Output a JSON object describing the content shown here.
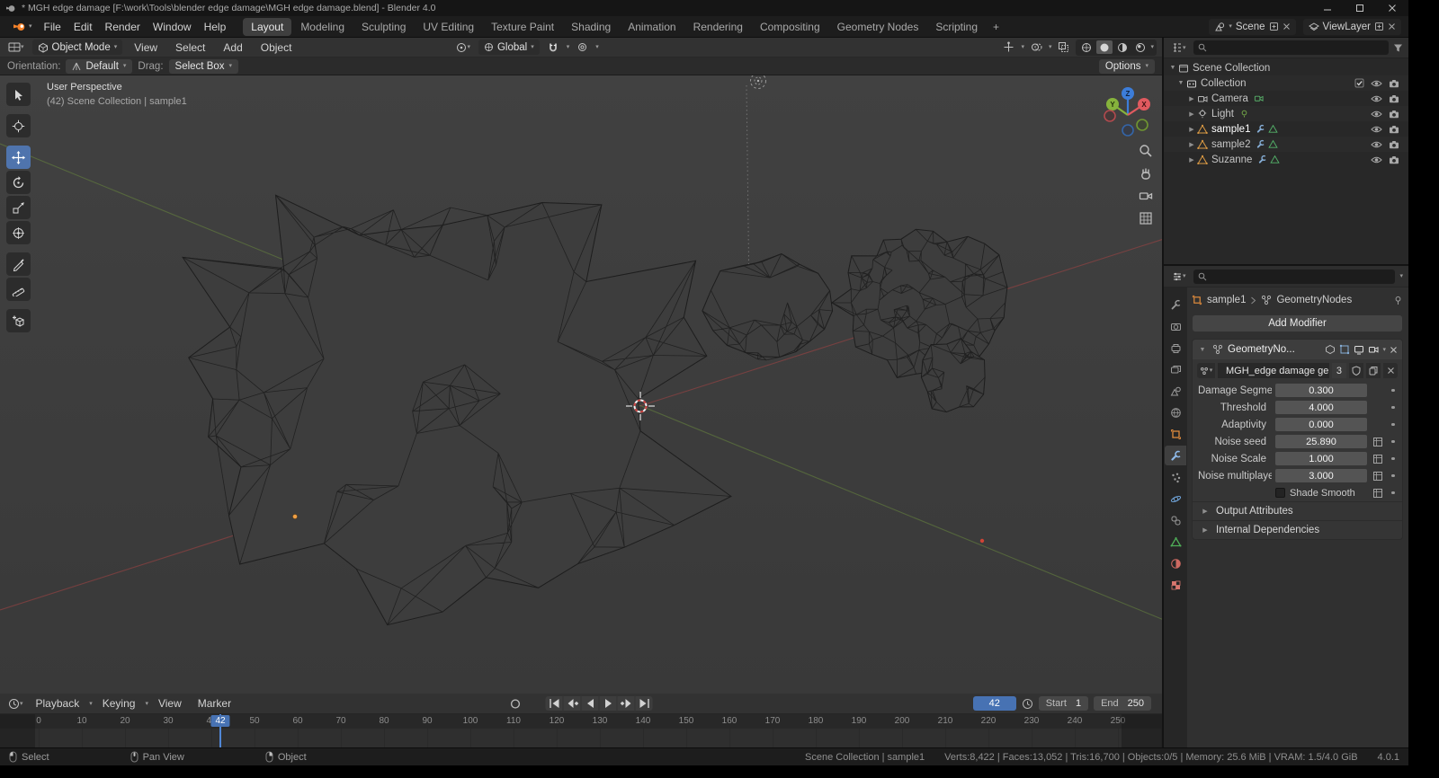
{
  "titlebar": {
    "title": "* MGH edge damage [F:\\work\\Tools\\blender edge damage\\MGH edge damage.blend] - Blender 4.0"
  },
  "topbar": {
    "menus": [
      "File",
      "Edit",
      "Render",
      "Window",
      "Help"
    ],
    "workspaces": [
      "Layout",
      "Modeling",
      "Sculpting",
      "UV Editing",
      "Texture Paint",
      "Shading",
      "Animation",
      "Rendering",
      "Compositing",
      "Geometry Nodes",
      "Scripting"
    ],
    "add_workspace": "+",
    "scene": {
      "label": "Scene"
    },
    "view_layer": {
      "label": "ViewLayer"
    }
  },
  "viewport": {
    "header": {
      "mode": "Object Mode",
      "menus": [
        "View",
        "Select",
        "Add",
        "Object"
      ],
      "transform_orientation": "Global"
    },
    "tool_settings": {
      "orientation_label": "Orientation:",
      "orientation_value": "Default",
      "drag_label": "Drag:",
      "drag_value": "Select Box",
      "options_label": "Options"
    },
    "overlay": {
      "line1": "User Perspective",
      "line2": "(42) Scene Collection | sample1"
    },
    "axis_gizmo": {
      "x": "X",
      "y": "Y",
      "z": "Z"
    }
  },
  "outliner": {
    "rows": [
      {
        "label": "Scene Collection"
      },
      {
        "label": "Collection"
      },
      {
        "label": "Camera"
      },
      {
        "label": "Light"
      },
      {
        "label": "sample1"
      },
      {
        "label": "sample2"
      },
      {
        "label": "Suzanne"
      }
    ]
  },
  "properties": {
    "breadcrumb": {
      "object": "sample1",
      "modifier": "GeometryNodes"
    },
    "add_modifier_label": "Add Modifier",
    "modifier": {
      "name": "GeometryNo...",
      "node_group": "MGH_edge damage gener...",
      "user_count": "3",
      "fields": [
        {
          "label": "Damage Segme...",
          "value": "0.300"
        },
        {
          "label": "Threshold",
          "value": "4.000"
        },
        {
          "label": "Adaptivity",
          "value": "0.000"
        },
        {
          "label": "Noise seed",
          "value": "25.890"
        },
        {
          "label": "Noise Scale",
          "value": "1.000"
        },
        {
          "label": "Noise multiplayer",
          "value": "3.000"
        }
      ],
      "shade_smooth_label": "Shade Smooth",
      "sections": [
        "Output Attributes",
        "Internal Dependencies"
      ]
    }
  },
  "timeline": {
    "menus": [
      "Playback",
      "Keying",
      "View",
      "Marker"
    ],
    "current_frame": "42",
    "start_label": "Start",
    "start_value": "1",
    "end_label": "End",
    "end_value": "250",
    "ticks": [
      "0",
      "10",
      "20",
      "30",
      "40",
      "50",
      "60",
      "70",
      "80",
      "90",
      "100",
      "110",
      "120",
      "130",
      "140",
      "150",
      "160",
      "170",
      "180",
      "190",
      "200",
      "210",
      "220",
      "230",
      "240",
      "250"
    ]
  },
  "statusbar": {
    "hints": [
      {
        "label": "Select"
      },
      {
        "label": "Pan View"
      },
      {
        "label": "Object"
      }
    ],
    "stats_left": "Scene Collection | sample1",
    "stats": "Verts:8,422 | Faces:13,052 | Tris:16,700 | Objects:0/5 | Memory: 25.6 MiB | VRAM: 1.5/4.0 GiB",
    "version": "4.0.1"
  }
}
